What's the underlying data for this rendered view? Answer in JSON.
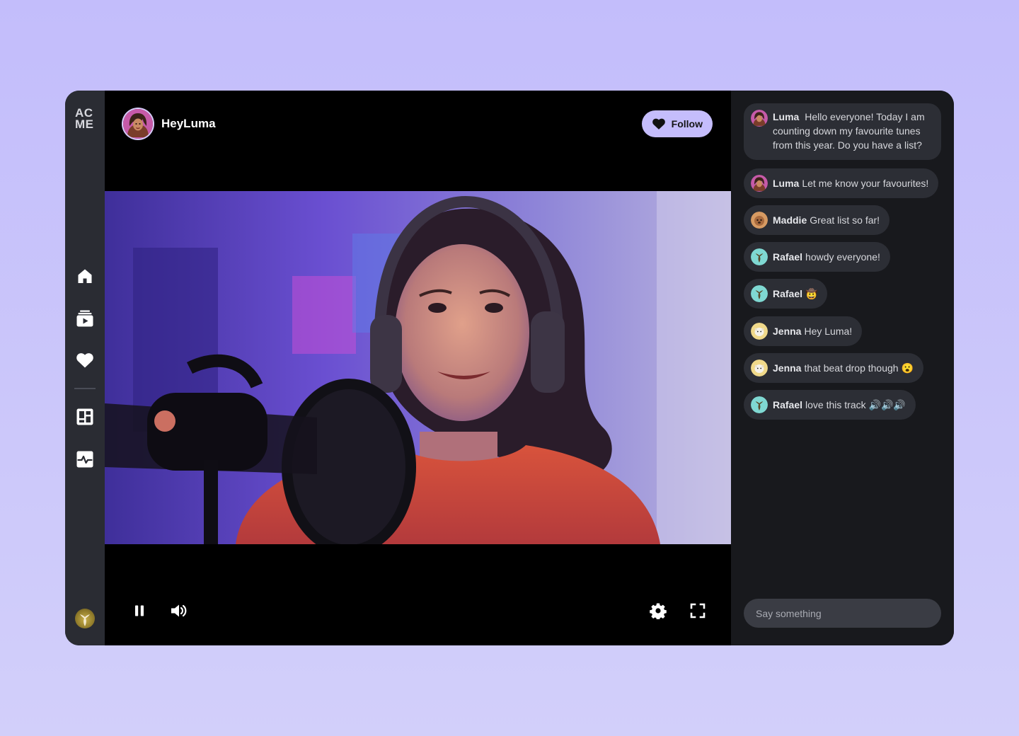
{
  "brand": {
    "logo_line1": "AC",
    "logo_line2": "ME"
  },
  "sidebar": {
    "items": [
      {
        "name": "home",
        "icon": "home-icon"
      },
      {
        "name": "videos",
        "icon": "video-library-icon"
      },
      {
        "name": "favourites",
        "icon": "heart-icon"
      },
      {
        "name": "dashboard",
        "icon": "dashboard-icon"
      },
      {
        "name": "activity",
        "icon": "activity-icon"
      }
    ],
    "user_avatar": "user-avatar"
  },
  "stream": {
    "streamer_name": "HeyLuma",
    "follow_label": "Follow",
    "controls": {
      "pause": "pause-icon",
      "volume": "volume-icon",
      "settings": "gear-icon",
      "fullscreen": "fullscreen-icon"
    }
  },
  "chat": {
    "messages": [
      {
        "user": "Luma",
        "text": "Hello everyone! Today I am counting down my favourite tunes from this year. Do you have a list?"
      },
      {
        "user": "Luma",
        "text": "Let me know your favourites!"
      },
      {
        "user": "Maddie",
        "text": "Great list so far!"
      },
      {
        "user": "Rafael",
        "text": "howdy everyone!"
      },
      {
        "user": "Rafael",
        "text": "🤠"
      },
      {
        "user": "Jenna",
        "text": "Hey Luma!"
      },
      {
        "user": "Jenna",
        "text": "that beat drop though 😮"
      },
      {
        "user": "Rafael",
        "text": "love this track 🔊🔊🔊"
      }
    ],
    "input_placeholder": "Say something"
  },
  "colors": {
    "background": "#c3bdfb",
    "sidebar": "#2a2c33",
    "chat_panel": "#18191d",
    "chat_bubble": "#2c2e35",
    "follow_button": "#c5bdfc"
  }
}
